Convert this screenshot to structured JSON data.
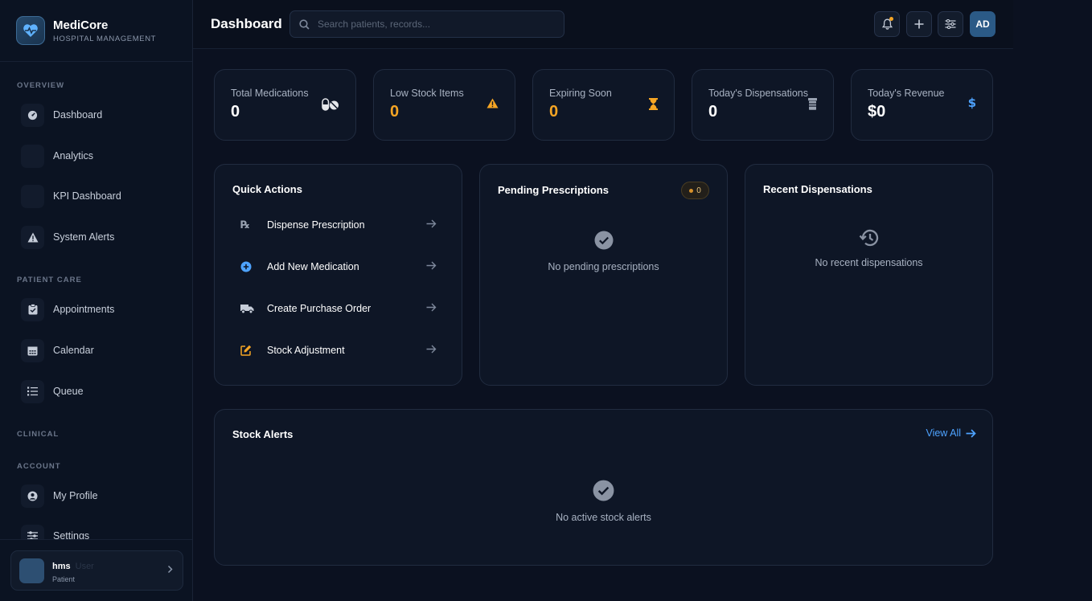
{
  "brand": {
    "name": "MediCore",
    "subtitle": "HOSPITAL MANAGEMENT"
  },
  "sidebar": {
    "sections": [
      {
        "title": "OVERVIEW",
        "items": [
          {
            "label": "Dashboard",
            "icon": "gauge-icon"
          },
          {
            "label": "Analytics",
            "icon": "chart-icon"
          },
          {
            "label": "KPI Dashboard",
            "icon": "kpi-icon"
          },
          {
            "label": "System Alerts",
            "icon": "warning-icon"
          }
        ]
      },
      {
        "title": "PATIENT CARE",
        "items": [
          {
            "label": "Appointments",
            "icon": "clipboard-check-icon"
          },
          {
            "label": "Calendar",
            "icon": "calendar-icon"
          },
          {
            "label": "Queue",
            "icon": "list-icon"
          }
        ]
      },
      {
        "title": "CLINICAL",
        "items": []
      },
      {
        "title": "ACCOUNT",
        "items": [
          {
            "label": "My Profile",
            "icon": "user-circle-icon"
          },
          {
            "label": "Settings",
            "icon": "sliders-icon"
          }
        ]
      }
    ],
    "user": {
      "name": "hms",
      "ghost": "User",
      "role": "Patient"
    }
  },
  "header": {
    "title": "Dashboard",
    "search_placeholder": "Search patients, records...",
    "avatar_initials": "AD"
  },
  "stats": [
    {
      "label": "Total Medications",
      "value": "0",
      "icon": "pills-icon"
    },
    {
      "label": "Low Stock Items",
      "value": "0",
      "icon": "warning-icon"
    },
    {
      "label": "Expiring Soon",
      "value": "0",
      "icon": "hourglass-icon"
    },
    {
      "label": "Today's Dispensations",
      "value": "0",
      "icon": "prescription-bottle-icon"
    },
    {
      "label": "Today's Revenue",
      "value": "$0",
      "icon": "dollar-icon"
    }
  ],
  "quick_actions": {
    "title": "Quick Actions",
    "items": [
      {
        "label": "Dispense Prescription",
        "icon": "rx-icon"
      },
      {
        "label": "Add New Medication",
        "icon": "plus-circle-icon"
      },
      {
        "label": "Create Purchase Order",
        "icon": "truck-icon"
      },
      {
        "label": "Stock Adjustment",
        "icon": "edit-icon"
      }
    ]
  },
  "pending": {
    "title": "Pending Prescriptions",
    "count": "0",
    "empty": "No pending prescriptions"
  },
  "recent": {
    "title": "Recent Dispensations",
    "empty": "No recent dispensations"
  },
  "stock_alerts": {
    "title": "Stock Alerts",
    "view_all": "View All",
    "empty": "No active stock alerts"
  },
  "colors": {
    "accent": "#4ea3ff",
    "warning": "#f5a524",
    "background": "#0b1120",
    "card": "#0e1626"
  }
}
